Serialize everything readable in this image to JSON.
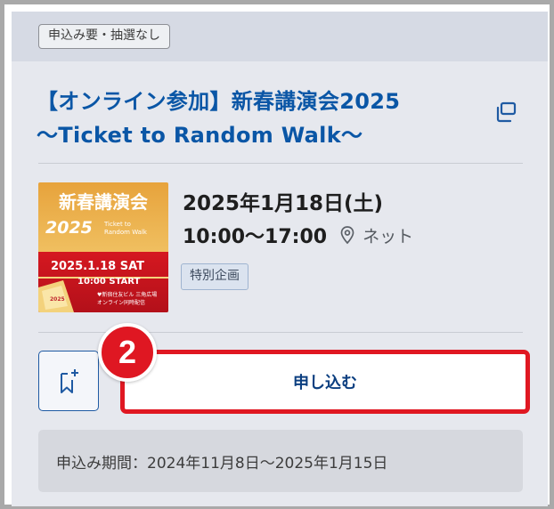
{
  "card": {
    "requirement_tag": "申込み要・抽選なし",
    "title_line1": "【オンライン参加】新春講演会2025",
    "title_line2": "～Ticket to Random Walk～"
  },
  "thumbnail": {
    "heading": "新春講演会",
    "year": "2025",
    "subtitle_line1": "Ticket to",
    "subtitle_line2": "Random Walk",
    "date_text": "2025.1.18 SAT",
    "time_text": "10:00 START",
    "venue_line1": "♥新宿住友ビル 三角広場",
    "venue_line2": "オンライン同時配信",
    "ticket_text": "2025"
  },
  "event": {
    "date": "2025年1月18日(土)",
    "time": "10:00～17:00",
    "location": "ネット",
    "category_badge": "特別企画"
  },
  "actions": {
    "step_number": "2",
    "apply_label": "申し込む"
  },
  "period": {
    "text": "申込み期間：2024年11月8日～2025年1月15日"
  },
  "colors": {
    "title_blue": "#0a56a6",
    "apply_text": "#0c3f80",
    "highlight_red": "#e01822",
    "card_background": "#e6e8ee"
  }
}
